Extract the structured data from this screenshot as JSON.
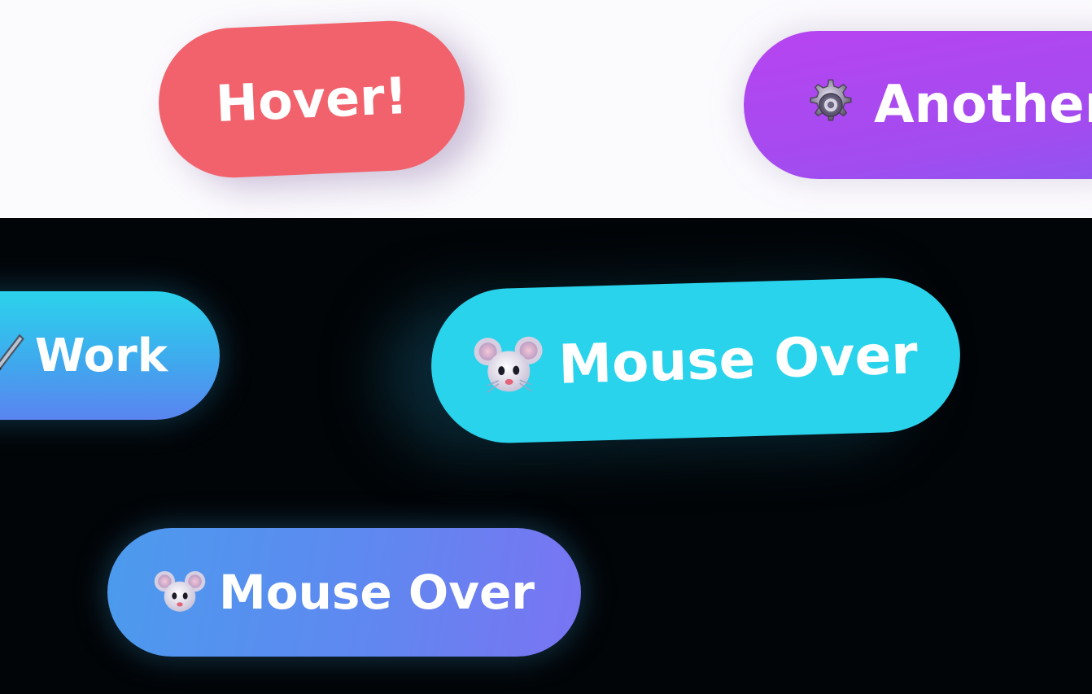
{
  "buttons": {
    "hover": {
      "label": "Hover!",
      "color": "#f2626c"
    },
    "another": {
      "label": "Another",
      "icon": "gear-icon",
      "color": "#b744f0"
    },
    "work": {
      "label": "Work",
      "icon": "wrench-icon",
      "color": "#2bd3ec"
    },
    "mouse_over_big": {
      "label": "Mouse Over",
      "icon": "mouse-icon",
      "color": "#29d3ec"
    },
    "mouse_over_small": {
      "label": "Mouse Over",
      "icon": "mouse-icon",
      "color": "#5f88f0"
    }
  },
  "theme": {
    "light_background": "#fbfafd",
    "dark_background": "#020508"
  }
}
